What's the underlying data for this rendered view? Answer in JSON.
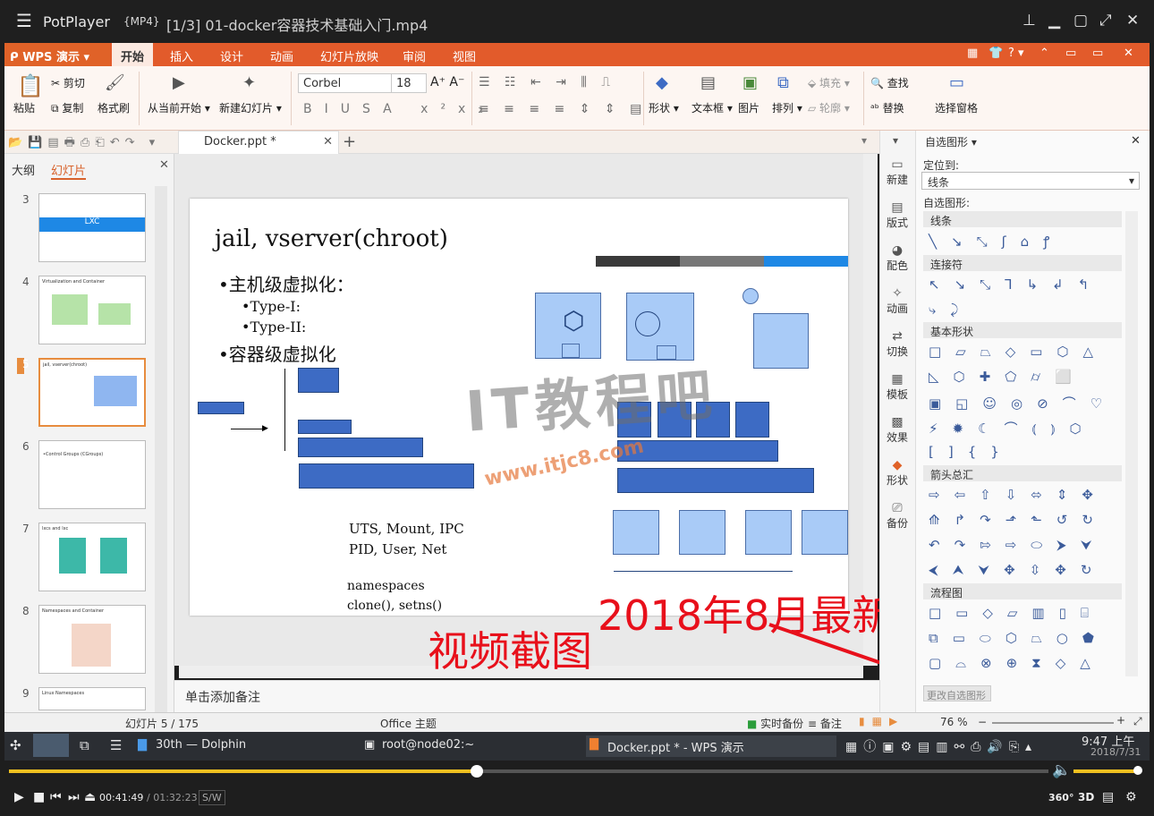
{
  "player": {
    "app": "PotPlayer",
    "format": "{MP4}",
    "file": "[1/3] 01-docker容器技术基础入门.mp4",
    "time_current": "00:41:49",
    "time_total": "/ 01:32:23",
    "sw": "S/W",
    "progress_fraction": 0.45,
    "r360": "360°",
    "r3d": "3D"
  },
  "wps": {
    "brand": "WPS 演示",
    "tabs": [
      "开始",
      "插入",
      "设计",
      "动画",
      "幻灯片放映",
      "审阅",
      "视图"
    ],
    "ribbon": {
      "paste": "粘贴",
      "cut": "剪切",
      "copy": "复制",
      "format_painter": "格式刷",
      "from_current": "从当前开始",
      "new_slide": "新建幻灯片",
      "font": "Corbel",
      "size": "18",
      "shape": "形状",
      "textbox": "文本框",
      "picture": "图片",
      "arrange": "排列",
      "fill": "填充",
      "outline": "轮廓",
      "find": "查找",
      "replace": "替换",
      "select_pane": "选择窗格"
    },
    "doc_tab": "Docker.ppt *",
    "left_tabs": [
      "大纲",
      "幻灯片"
    ],
    "thumbs": [
      "3",
      "4",
      "5",
      "6",
      "7",
      "8",
      "9"
    ],
    "thumb_titles": {
      "t3": "LXC",
      "t4": "Virtualization and Container",
      "t5": "jail, vserver(chroot)",
      "t6": "•Control Groups (CGroups)",
      "t7": "lxcs and lxc",
      "t8": "Namespaces and Container",
      "t9": "Linux Namespaces"
    },
    "notes_placeholder": "单击添加备注",
    "status": {
      "slide": "幻灯片 5 / 175",
      "theme": "Office 主题",
      "backup": "实时备份",
      "notes": "备注",
      "zoom": "76 %"
    },
    "task_icons": [
      "新建",
      "版式",
      "配色",
      "动画",
      "切换",
      "模板",
      "效果",
      "形状",
      "备份"
    ],
    "shape_pane": {
      "title": "自选图形",
      "locate_label": "定位到:",
      "locate_value": "线条",
      "auto_shapes": "自选图形:",
      "categories": [
        "线条",
        "连接符",
        "基本形状",
        "箭头总汇",
        "流程图"
      ],
      "more": "更改自选图形"
    }
  },
  "slide": {
    "title": "jail, vserver(chroot)",
    "bullets": [
      "•主机级虚拟化：",
      "•Type-I:",
      "•Type-II:",
      "•容器级虚拟化"
    ],
    "ns1": "UTS, Mount, IPC",
    "ns2": "PID, User, Net",
    "ns3": "namespaces",
    "ns4": "clone(), setns()"
  },
  "taskbar": {
    "items": [
      "30th — Dolphin",
      "root@node02:~",
      "Docker.ppt * - WPS 演示"
    ],
    "time": "9:47 上午",
    "date": "2018/7/31"
  },
  "overlay": {
    "headline": "2018年8月最新",
    "caption": "视频截图",
    "logo": "IT教程吧",
    "url": "www.itjc8.com"
  },
  "colors": {
    "wps_orange": "#e25b2b",
    "box_dark": "#3d6bc4",
    "box_light": "#a9cbf7",
    "seek": "#f0c020",
    "annotation_red": "#e8101b"
  }
}
